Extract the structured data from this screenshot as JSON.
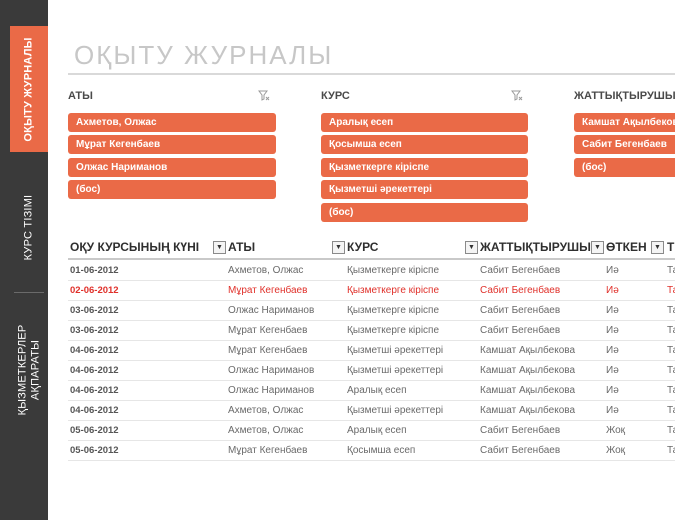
{
  "sidebar": {
    "tabs": [
      {
        "label": "ОҚЫТУ ЖУРНАЛЫ",
        "active": true
      },
      {
        "label": "КУРС ТІЗІМІ",
        "active": false
      },
      {
        "label": "ҚЫЗМЕТКЕРЛЕР АҚПАРАТЫ",
        "active": false
      }
    ]
  },
  "page": {
    "title": "ОҚЫТУ ЖУРНАЛЫ"
  },
  "slicers": [
    {
      "title": "АТЫ",
      "items": [
        "Ахметов, Олжас",
        "Мұрат Кегенбаев",
        "Олжас Нариманов",
        "(бос)"
      ]
    },
    {
      "title": "КУРС",
      "items": [
        "Аралық есеп",
        "Қосымша есеп",
        "Қызметкерге кіріспе",
        "Қызметші әрекеттері",
        "(бос)"
      ]
    },
    {
      "title": "ЖАТТЫҚТЫРУШЫ",
      "items": [
        "Камшат Ақылбекова",
        "Сабит Бегенбаев",
        "(бос)"
      ]
    }
  ],
  "table": {
    "headers": [
      "ОҚУ КУРСЫНЫҢ КҮНІ",
      "АТЫ",
      "КУРС",
      "ЖАТТЫҚТЫРУШЫ",
      "ӨТКЕН",
      "Т"
    ],
    "rows": [
      [
        "01-06-2012",
        "Ахметов, Олжас",
        "Қызметкерге кіріспе",
        "Сабит Бегенбаев",
        "Иә",
        "Та"
      ],
      [
        "02-06-2012",
        "Мұрат Кегенбаев",
        "Қызметкерге кіріспе",
        "Сабит Бегенбаев",
        "Иә",
        "Та"
      ],
      [
        "03-06-2012",
        "Олжас Нариманов",
        "Қызметкерге кіріспе",
        "Сабит Бегенбаев",
        "Иә",
        "Та"
      ],
      [
        "03-06-2012",
        "Мұрат Кегенбаев",
        "Қызметкерге кіріспе",
        "Сабит Бегенбаев",
        "Иә",
        "Та"
      ],
      [
        "04-06-2012",
        "Мұрат Кегенбаев",
        "Қызметші әрекеттері",
        "Камшат Ақылбекова",
        "Иә",
        "Та"
      ],
      [
        "04-06-2012",
        "Олжас Нариманов",
        "Қызметші әрекеттері",
        "Камшат Ақылбекова",
        "Иә",
        "Та"
      ],
      [
        "04-06-2012",
        "Олжас Нариманов",
        "Аралық есеп",
        "Камшат Ақылбекова",
        "Иә",
        "Та"
      ],
      [
        "04-06-2012",
        "Ахметов, Олжас",
        "Қызметші әрекеттері",
        "Камшат Ақылбекова",
        "Иә",
        "Та"
      ],
      [
        "05-06-2012",
        "Ахметов, Олжас",
        "Аралық есеп",
        "Сабит Бегенбаев",
        "Жоқ",
        "Та"
      ],
      [
        "05-06-2012",
        "Мұрат Кегенбаев",
        "Қосымша есеп",
        "Сабит Бегенбаев",
        "Жоқ",
        "Та"
      ]
    ],
    "highlighted_row": 1
  },
  "colors": {
    "accent": "#ea6a47",
    "sidebar": "#3a3a3a",
    "highlight_text": "#e0302a"
  },
  "icons": {
    "slicer_clear": "clear-filter-icon",
    "column_filter": "dropdown-arrow-icon"
  }
}
